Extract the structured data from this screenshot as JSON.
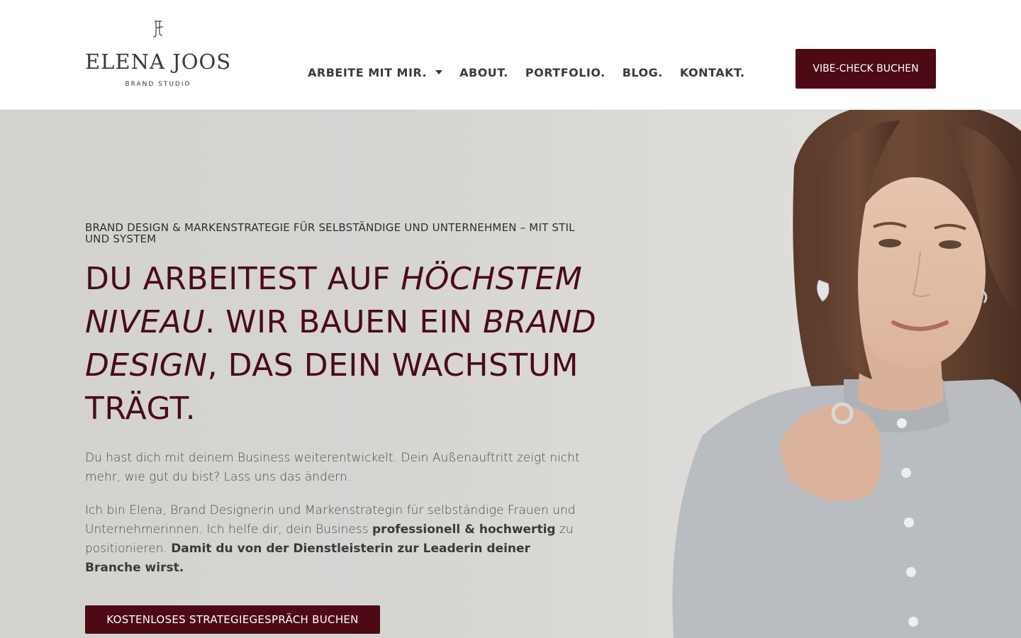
{
  "header": {
    "logo_name": "ELENA JOOS",
    "logo_sub": "BRAND STUDIO",
    "nav": [
      {
        "label": "ARBEITE MIT MIR."
      },
      {
        "label": "ABOUT."
      },
      {
        "label": "PORTFOLIO."
      },
      {
        "label": "BLOG."
      },
      {
        "label": "KONTAKT."
      }
    ],
    "cta_label": "VIBE-CHECK BUCHEN"
  },
  "hero": {
    "eyebrow": "BRAND DESIGN & MARKENSTRATEGIE FÜR SELBSTÄNDIGE UND UNTERNEHMEN – MIT STIL UND SYSTEM",
    "headline_parts": [
      "DU ARBEITEST AUF ",
      "HÖCHSTEM NIVEAU",
      ". WIR BAUEN EIN ",
      "BRAND DESIGN",
      ", DAS DEIN WACHSTUM TRÄGT."
    ],
    "para1": "Du hast dich mit deinem Business weiterentwickelt. Dein Außenauftritt zeigt nicht mehr, wie gut du bist? Lass uns das ändern.",
    "para2_parts": [
      "Ich bin Elena, Brand Designerin und Markenstrategin für selbständige Frauen und Unternehmerinnen. Ich helfe dir, dein Business ",
      "professionell & hochwertig",
      " zu positionieren. ",
      "Damit du von der Dienstleisterin zur Leaderin deiner Branche wirst."
    ],
    "cta_label": "KOSTENLOSES STRATEGIEGESPRÄCH BUCHEN"
  },
  "colors": {
    "accent": "#4d0a15",
    "headline": "#4a0c17",
    "hero_bg": "#d6d5d2"
  }
}
